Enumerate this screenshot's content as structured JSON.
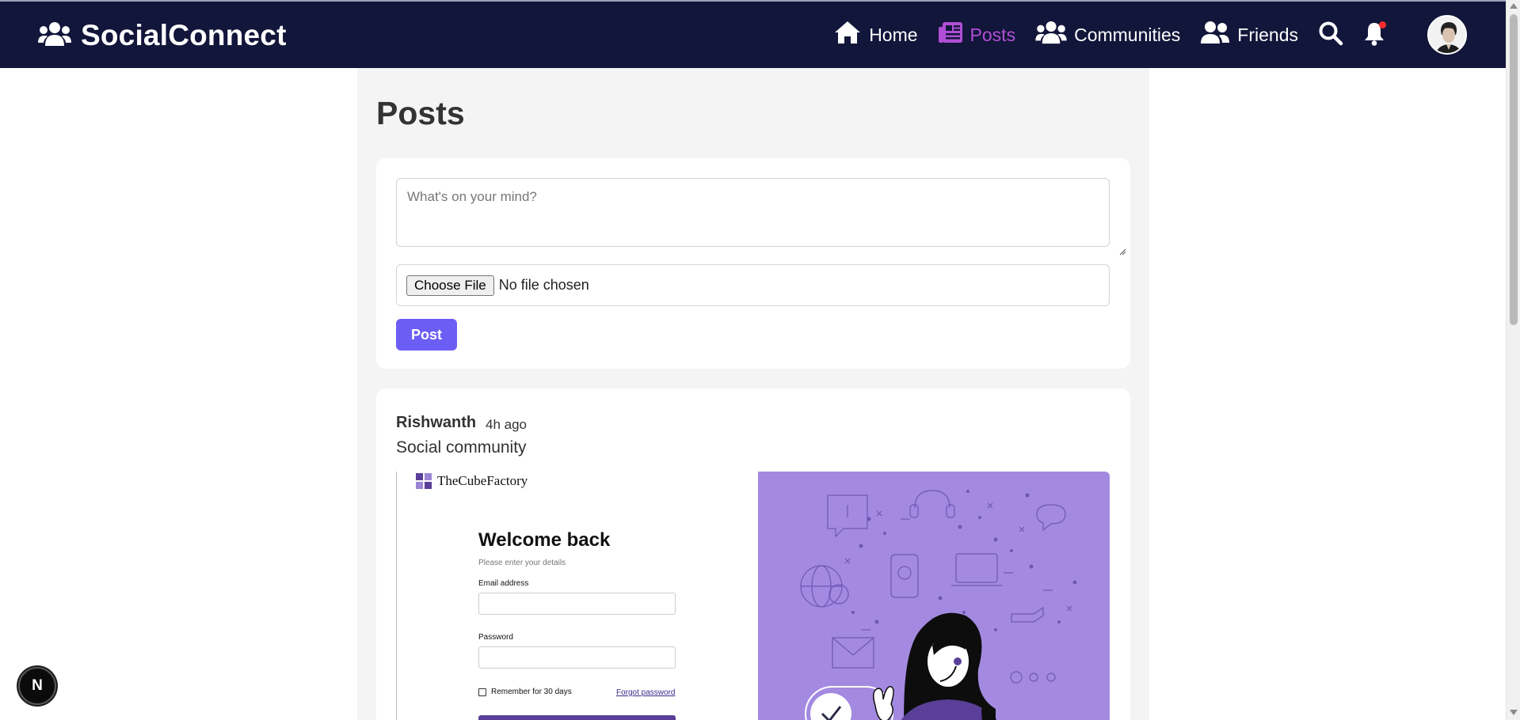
{
  "app": {
    "name": "SocialConnect",
    "logo_icon": "users-icon"
  },
  "nav": {
    "items": [
      {
        "label": "Home",
        "icon": "home-icon",
        "active": false
      },
      {
        "label": "Posts",
        "icon": "newspaper-icon",
        "active": true
      },
      {
        "label": "Communities",
        "icon": "users-icon",
        "active": false
      },
      {
        "label": "Friends",
        "icon": "user-friends-icon",
        "active": false
      }
    ],
    "search_icon": "search-icon",
    "notifications_icon": "bell-icon",
    "has_unread_notifications": true,
    "avatar": "user-avatar"
  },
  "colors": {
    "navbar": "#12163a",
    "accent": "#b04fd6",
    "button": "#6c5ef5",
    "notification_dot": "#ff2d2d"
  },
  "page": {
    "title": "Posts"
  },
  "composer": {
    "placeholder": "What's on your mind?",
    "value": "",
    "file_button_label": "Choose File",
    "file_status": "No file chosen",
    "post_button_label": "Post"
  },
  "posts": [
    {
      "author": "Rishwanth",
      "time": "4h ago",
      "text": "Social community",
      "image": {
        "brand": "TheCubeFactory",
        "heading": "Welcome back",
        "subheading": "Please enter your details",
        "email_label": "Email address",
        "password_label": "Password",
        "remember_label": "Remember for 30 days",
        "forgot_label": "Forgot password"
      }
    }
  ],
  "dev_badge": {
    "label": "N"
  }
}
